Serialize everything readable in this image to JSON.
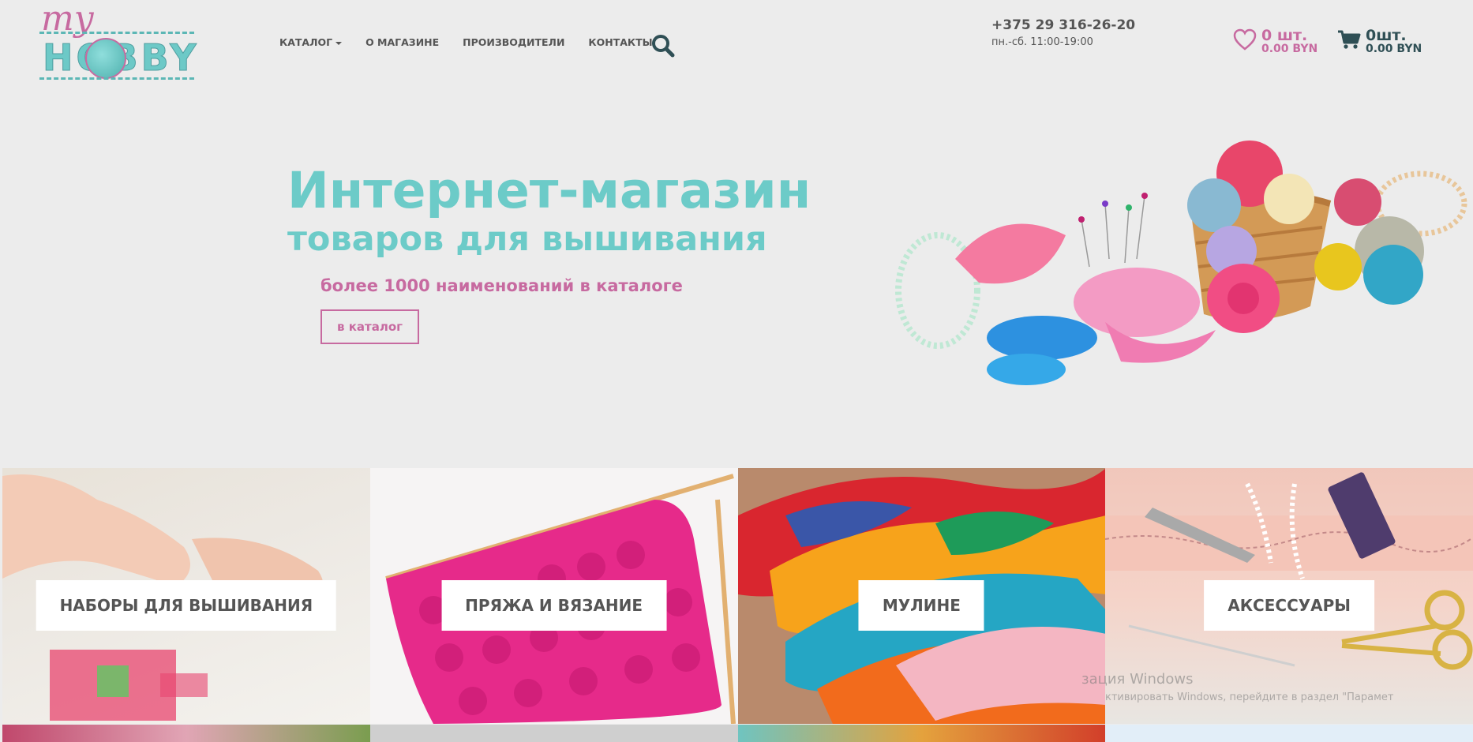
{
  "logo": {
    "line1": "my",
    "line2": "HOBBY"
  },
  "nav": {
    "items": [
      {
        "label": "Каталог",
        "has_caret": true
      },
      {
        "label": "О магазине"
      },
      {
        "label": "Производители"
      },
      {
        "label": "Контакты"
      }
    ]
  },
  "contacts": {
    "phone": "+375 29 316-26-20",
    "hours": "пн.-сб. 11:00-19:00"
  },
  "wishlist": {
    "count": "0 шт.",
    "sum": "0.00 BYN"
  },
  "cart": {
    "count": "0шт.",
    "sum": "0.00 BYN"
  },
  "hero": {
    "title": "Интернет-магазин",
    "subtitle": "товаров для вышивания",
    "note": "более 1000 наименований в каталоге",
    "button": "в каталог"
  },
  "categories": [
    {
      "label": "Наборы для вышивания"
    },
    {
      "label": "Пряжа и вязание"
    },
    {
      "label": "Мулине"
    },
    {
      "label": "Аксессуары"
    }
  ],
  "windows_watermark": {
    "line1": "зация Windows",
    "line2": "ктивировать Windows, перейдите в раздел \"Парамет"
  },
  "colors": {
    "teal": "#6ccbc8",
    "pink": "#c76aa0",
    "dark": "#2f4f55"
  }
}
